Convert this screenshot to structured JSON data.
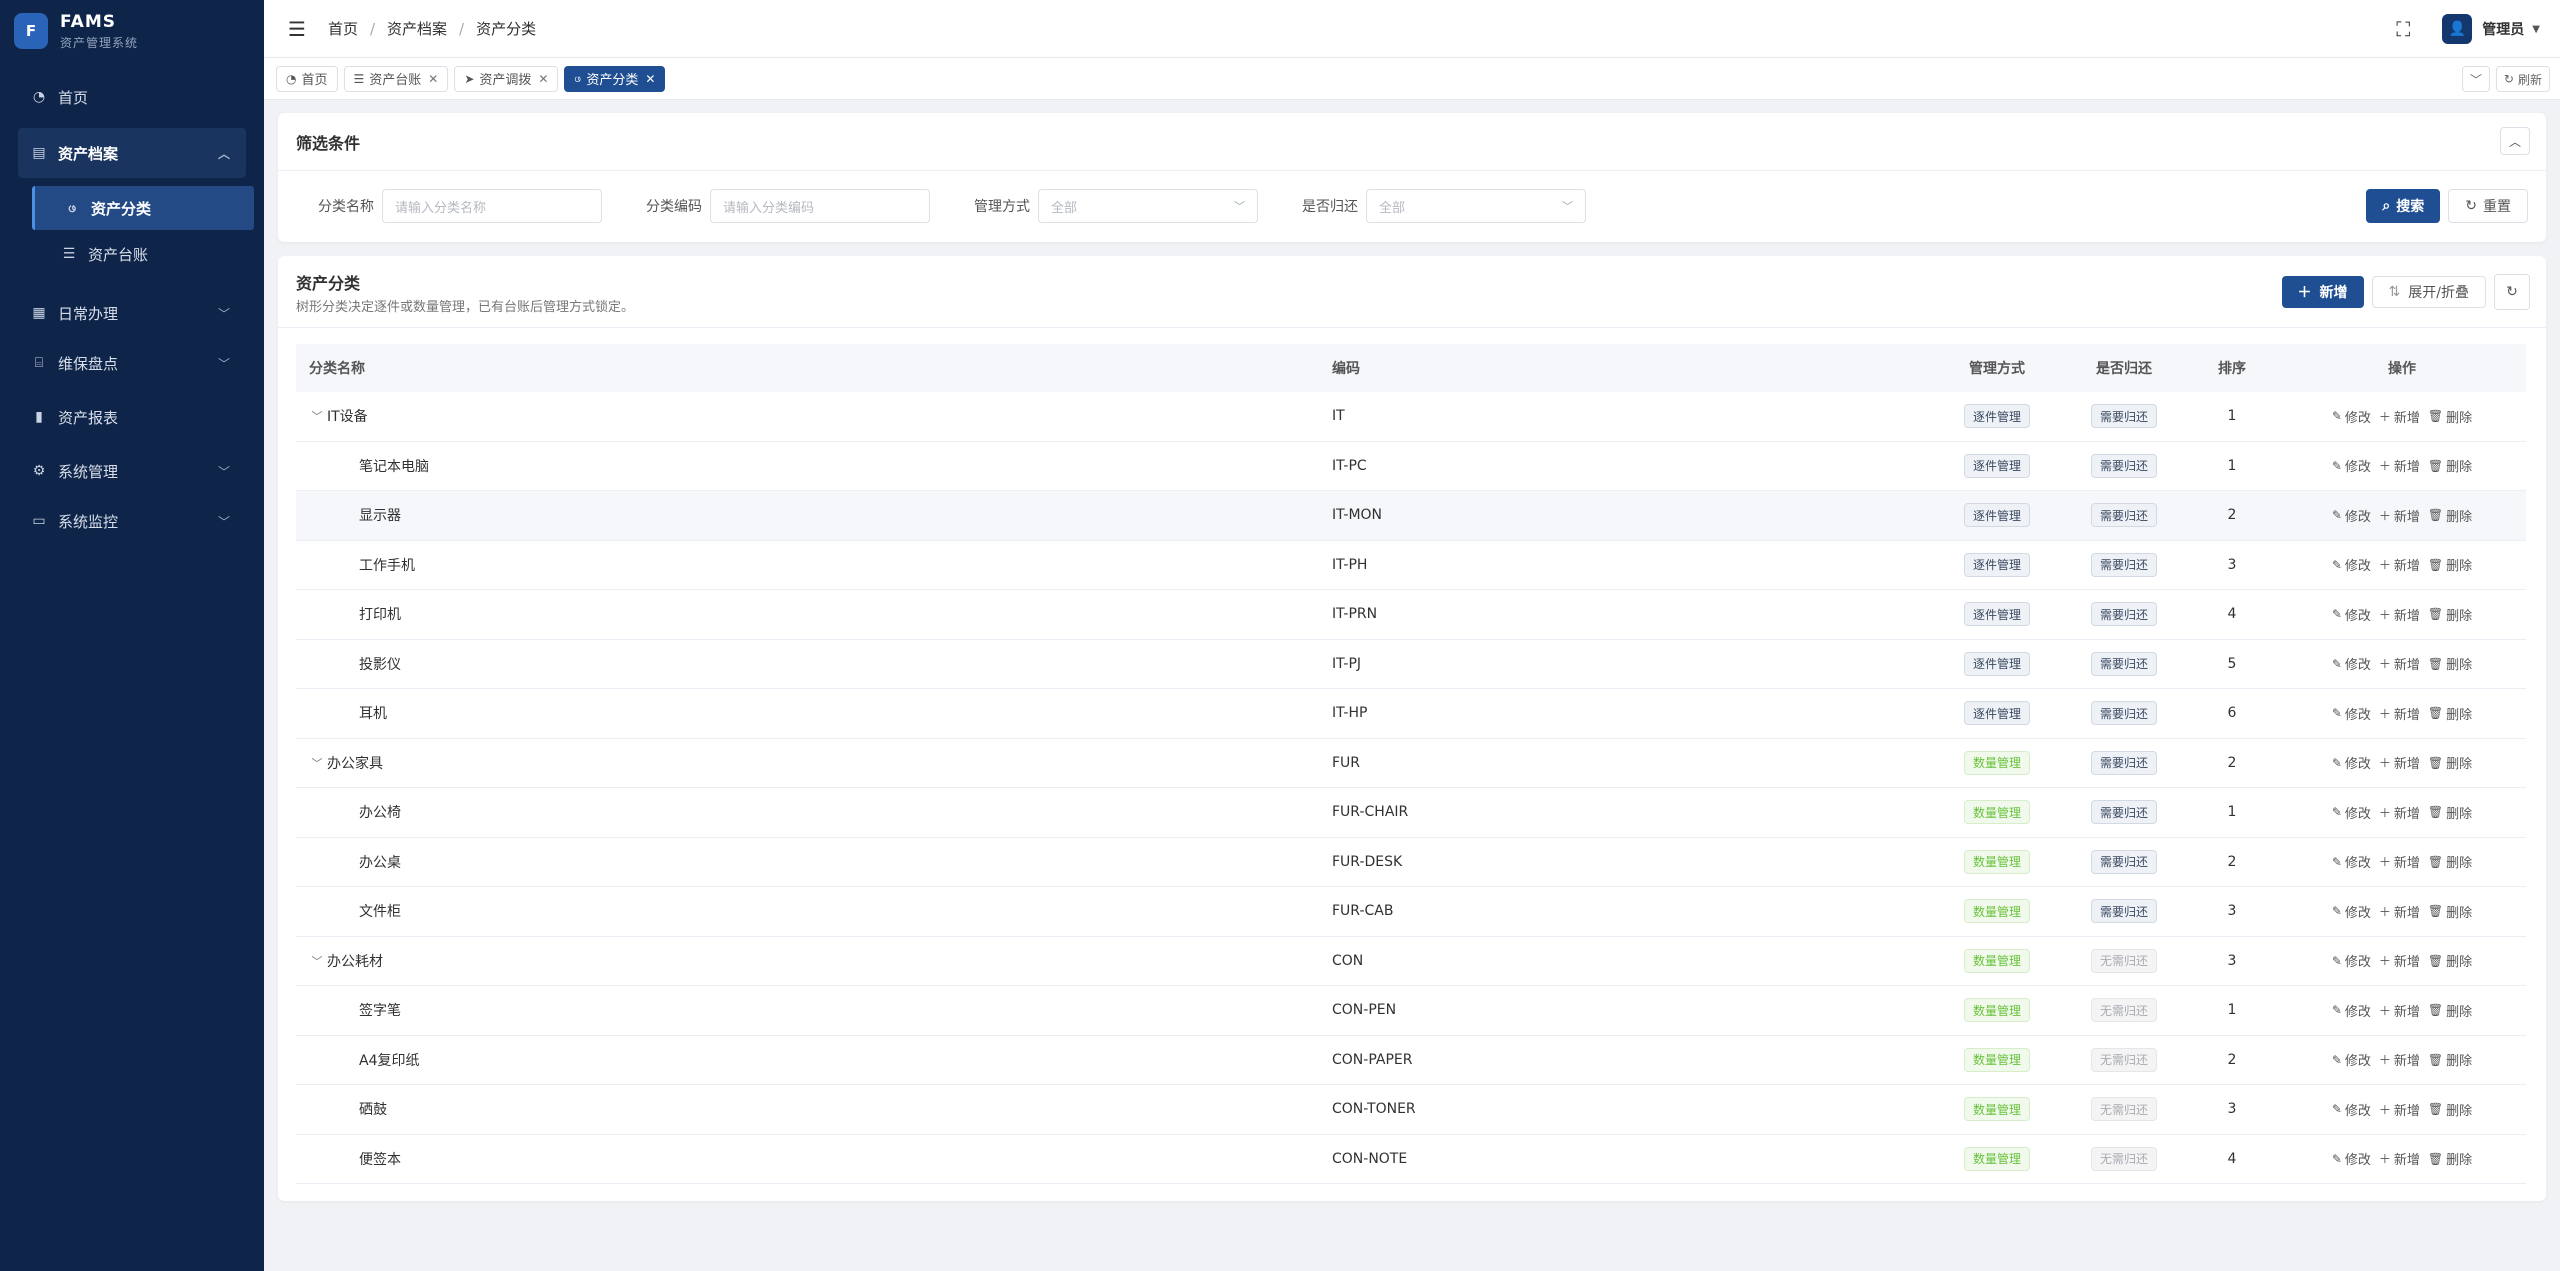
{
  "app": {
    "logo_mark": "F",
    "title": "FAMS",
    "subtitle": "资产管理系统"
  },
  "sidebar": {
    "items": [
      {
        "label": "首页",
        "icon": "dashboard-icon"
      },
      {
        "label": "资产档案",
        "icon": "file-icon",
        "expanded": true
      },
      {
        "label": "资产分类",
        "icon": "tree-icon",
        "active": true
      },
      {
        "label": "资产台账",
        "icon": "list-icon"
      },
      {
        "label": "日常办理",
        "icon": "document-icon"
      },
      {
        "label": "维保盘点",
        "icon": "briefcase-icon"
      },
      {
        "label": "资产报表",
        "icon": "bar-chart-icon"
      },
      {
        "label": "系统管理",
        "icon": "gear-icon"
      },
      {
        "label": "系统监控",
        "icon": "monitor-icon"
      }
    ]
  },
  "header": {
    "breadcrumb": [
      "首页",
      "资产档案",
      "资产分类"
    ],
    "user": "管理员"
  },
  "tabs": [
    {
      "label": "首页",
      "closable": false
    },
    {
      "label": "资产台账",
      "closable": true
    },
    {
      "label": "资产调拨",
      "closable": true
    },
    {
      "label": "资产分类",
      "closable": true,
      "active": true
    }
  ],
  "tabs_right": {
    "refresh_label": "刷新"
  },
  "filter": {
    "title": "筛选条件",
    "fields": [
      {
        "label": "分类名称",
        "placeholder": "请输入分类名称"
      },
      {
        "label": "分类编码",
        "placeholder": "请输入分类编码"
      },
      {
        "label": "管理方式",
        "value": "全部"
      },
      {
        "label": "是否归还",
        "value": "全部"
      }
    ],
    "search_label": "搜索",
    "reset_label": "重置"
  },
  "table_panel": {
    "title": "资产分类",
    "subtitle": "树形分类决定逐件或数量管理，已有台账后管理方式锁定。",
    "add_label": "新增",
    "toggle_label": "展开/折叠"
  },
  "table": {
    "columns": [
      "分类名称",
      "编码",
      "管理方式",
      "是否归还",
      "排序",
      "操作"
    ],
    "ops": [
      "修改",
      "新增",
      "删除"
    ],
    "rows": [
      {
        "name": "IT设备",
        "code": "IT",
        "mode": "逐件管理",
        "ret": "需要归还",
        "sort": "1",
        "level": 0
      },
      {
        "name": "笔记本电脑",
        "code": "IT-PC",
        "mode": "逐件管理",
        "ret": "需要归还",
        "sort": "1",
        "level": 1
      },
      {
        "name": "显示器",
        "code": "IT-MON",
        "mode": "逐件管理",
        "ret": "需要归还",
        "sort": "2",
        "level": 1
      },
      {
        "name": "工作手机",
        "code": "IT-PH",
        "mode": "逐件管理",
        "ret": "需要归还",
        "sort": "3",
        "level": 1
      },
      {
        "name": "打印机",
        "code": "IT-PRN",
        "mode": "逐件管理",
        "ret": "需要归还",
        "sort": "4",
        "level": 1
      },
      {
        "name": "投影仪",
        "code": "IT-PJ",
        "mode": "逐件管理",
        "ret": "需要归还",
        "sort": "5",
        "level": 1
      },
      {
        "name": "耳机",
        "code": "IT-HP",
        "mode": "逐件管理",
        "ret": "需要归还",
        "sort": "6",
        "level": 1
      },
      {
        "name": "办公家具",
        "code": "FUR",
        "mode": "数量管理",
        "ret": "需要归还",
        "sort": "2",
        "level": 0
      },
      {
        "name": "办公椅",
        "code": "FUR-CHAIR",
        "mode": "数量管理",
        "ret": "需要归还",
        "sort": "1",
        "level": 1
      },
      {
        "name": "办公桌",
        "code": "FUR-DESK",
        "mode": "数量管理",
        "ret": "需要归还",
        "sort": "2",
        "level": 1
      },
      {
        "name": "文件柜",
        "code": "FUR-CAB",
        "mode": "数量管理",
        "ret": "需要归还",
        "sort": "3",
        "level": 1
      },
      {
        "name": "办公耗材",
        "code": "CON",
        "mode": "数量管理",
        "ret": "无需归还",
        "sort": "3",
        "level": 0
      },
      {
        "name": "签字笔",
        "code": "CON-PEN",
        "mode": "数量管理",
        "ret": "无需归还",
        "sort": "1",
        "level": 1
      },
      {
        "name": "A4复印纸",
        "code": "CON-PAPER",
        "mode": "数量管理",
        "ret": "无需归还",
        "sort": "2",
        "level": 1
      },
      {
        "name": "硒鼓",
        "code": "CON-TONER",
        "mode": "数量管理",
        "ret": "无需归还",
        "sort": "3",
        "level": 1
      },
      {
        "name": "便签本",
        "code": "CON-NOTE",
        "mode": "数量管理",
        "ret": "无需归还",
        "sort": "4",
        "level": 1
      }
    ]
  },
  "colors": {
    "sidebar_bg": "#0e2549",
    "primary": "#1f4f92",
    "green": "#67c23a"
  }
}
